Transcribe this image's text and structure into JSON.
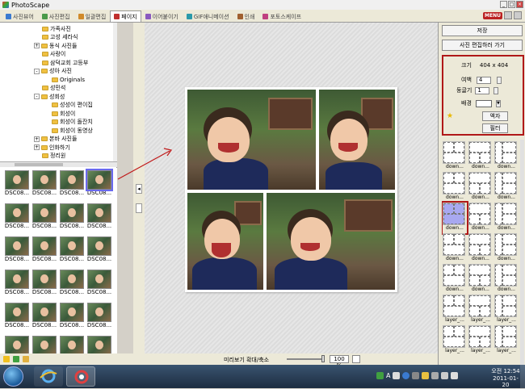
{
  "window": {
    "title": "PhotoScape"
  },
  "tabs": [
    {
      "label": "사진뷰어",
      "color": "#3a7ad0"
    },
    {
      "label": "사진편집",
      "color": "#4a9a4a"
    },
    {
      "label": "일괄편집",
      "color": "#d08a2a"
    },
    {
      "label": "페이지",
      "color": "#c03030",
      "active": true
    },
    {
      "label": "이어붙이기",
      "color": "#8a5ac0"
    },
    {
      "label": "GIF애니메이션",
      "color": "#2a9aaa"
    },
    {
      "label": "인쇄",
      "color": "#a06030"
    },
    {
      "label": "포토스케이프",
      "color": "#c04080"
    }
  ],
  "topright": {
    "menu_label": "MENU"
  },
  "tree": [
    {
      "label": "가족사진",
      "indent": 2,
      "exp": ""
    },
    {
      "label": "고성 세라식",
      "indent": 2,
      "exp": ""
    },
    {
      "label": "동식 사진들",
      "indent": 2,
      "exp": "+"
    },
    {
      "label": "사랑이",
      "indent": 2,
      "exp": ""
    },
    {
      "label": "삼덕교회 고등부",
      "indent": 2,
      "exp": ""
    },
    {
      "label": "성아 사진",
      "indent": 2,
      "exp": "-"
    },
    {
      "label": "Originals",
      "indent": 3,
      "exp": ""
    },
    {
      "label": "성민석",
      "indent": 2,
      "exp": ""
    },
    {
      "label": "성회성",
      "indent": 2,
      "exp": "-"
    },
    {
      "label": "성성이 편이집",
      "indent": 3,
      "exp": ""
    },
    {
      "label": "회성이",
      "indent": 3,
      "exp": ""
    },
    {
      "label": "회성이 돌잔치",
      "indent": 3,
      "exp": ""
    },
    {
      "label": "회성이 동영상",
      "indent": 3,
      "exp": ""
    },
    {
      "label": "본바 사진들",
      "indent": 2,
      "exp": "+"
    },
    {
      "label": "인화하기",
      "indent": 2,
      "exp": "+"
    },
    {
      "label": "정리원",
      "indent": 2,
      "exp": ""
    }
  ],
  "thumbnails": [
    {
      "label": "DSC08..."
    },
    {
      "label": "DSC08..."
    },
    {
      "label": "DSC08..."
    },
    {
      "label": "DSC08...",
      "selected": true
    },
    {
      "label": "DSC08..."
    },
    {
      "label": "DSC08..."
    },
    {
      "label": "DSC08..."
    },
    {
      "label": "DSC08..."
    },
    {
      "label": "DSC08..."
    },
    {
      "label": "DSC08..."
    },
    {
      "label": "DSC08..."
    },
    {
      "label": "DSC08..."
    },
    {
      "label": "DSC08..."
    },
    {
      "label": "DSC08..."
    },
    {
      "label": "DSC08..."
    },
    {
      "label": "DSC08..."
    },
    {
      "label": "DSC08..."
    },
    {
      "label": "DSC08..."
    },
    {
      "label": "DSC08..."
    },
    {
      "label": "DSC08..."
    },
    {
      "label": ""
    },
    {
      "label": ""
    },
    {
      "label": ""
    },
    {
      "label": ""
    }
  ],
  "bottombar": {
    "zoom_label": "미리보기 확대/축소",
    "zoom_value": "100 %"
  },
  "right": {
    "save_label": "저장",
    "edit_label": "사진 편집하러 가기",
    "size_label": "크기",
    "size_value": "404 x 404",
    "margin_label": "여백",
    "margin_value": "4",
    "round_label": "둥글기",
    "round_value": "1",
    "bg_label": "배경",
    "frame_label": "액자",
    "filter_label": "필터"
  },
  "layouts": [
    {
      "label": "down..."
    },
    {
      "label": "down..."
    },
    {
      "label": "down..."
    },
    {
      "label": "down..."
    },
    {
      "label": "down..."
    },
    {
      "label": "down..."
    },
    {
      "label": "down...",
      "selected": true
    },
    {
      "label": "down..."
    },
    {
      "label": "down..."
    },
    {
      "label": "down..."
    },
    {
      "label": "down..."
    },
    {
      "label": "down..."
    },
    {
      "label": "down..."
    },
    {
      "label": "down..."
    },
    {
      "label": "down..."
    },
    {
      "label": "layer_..."
    },
    {
      "label": "layer_..."
    },
    {
      "label": "layer_..."
    },
    {
      "label": "layer_..."
    },
    {
      "label": "layer_..."
    },
    {
      "label": "layer_..."
    }
  ],
  "taskbar": {
    "lang_label": "A",
    "clock_time": "오전 12:54",
    "clock_date": "2011-01-20"
  }
}
